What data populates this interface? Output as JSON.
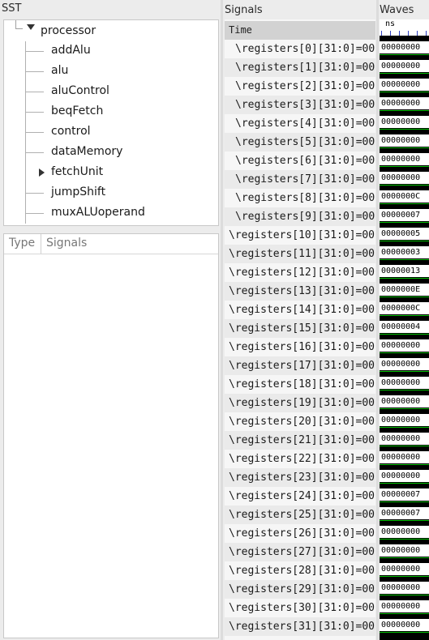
{
  "sst": {
    "label": "SST",
    "root": "processor",
    "children": [
      {
        "label": "addAlu",
        "expandable": false
      },
      {
        "label": "alu",
        "expandable": false
      },
      {
        "label": "aluControl",
        "expandable": false
      },
      {
        "label": "beqFetch",
        "expandable": false
      },
      {
        "label": "control",
        "expandable": false
      },
      {
        "label": "dataMemory",
        "expandable": false
      },
      {
        "label": "fetchUnit",
        "expandable": true
      },
      {
        "label": "jumpShift",
        "expandable": false
      },
      {
        "label": "muxALUoperand",
        "expandable": false
      }
    ]
  },
  "type_panel": {
    "type_header": "Type",
    "signals_header": "Signals"
  },
  "signals": {
    "label": "Signals",
    "time_label": "Time",
    "rows": [
      "\\registers[0][31:0]=00",
      "\\registers[1][31:0]=00",
      "\\registers[2][31:0]=00",
      "\\registers[3][31:0]=00",
      "\\registers[4][31:0]=00",
      "\\registers[5][31:0]=00",
      "\\registers[6][31:0]=00",
      "\\registers[7][31:0]=00",
      "\\registers[8][31:0]=00",
      "\\registers[9][31:0]=00",
      "\\registers[10][31:0]=00",
      "\\registers[11][31:0]=00",
      "\\registers[12][31:0]=00",
      "\\registers[13][31:0]=00",
      "\\registers[14][31:0]=00",
      "\\registers[15][31:0]=00",
      "\\registers[16][31:0]=00",
      "\\registers[17][31:0]=00",
      "\\registers[18][31:0]=00",
      "\\registers[19][31:0]=00",
      "\\registers[20][31:0]=00",
      "\\registers[21][31:0]=00",
      "\\registers[22][31:0]=00",
      "\\registers[23][31:0]=00",
      "\\registers[24][31:0]=00",
      "\\registers[25][31:0]=00",
      "\\registers[26][31:0]=00",
      "\\registers[27][31:0]=00",
      "\\registers[28][31:0]=00",
      "\\registers[29][31:0]=00",
      "\\registers[30][31:0]=00",
      "\\registers[31][31:0]=00"
    ]
  },
  "waves": {
    "label": "Waves",
    "unit": "ns",
    "values": [
      "00000000",
      "00000000",
      "00000000",
      "00000000",
      "00000000",
      "00000000",
      "00000000",
      "00000000",
      "0000000C",
      "00000007",
      "00000005",
      "00000003",
      "00000013",
      "0000000E",
      "0000000C",
      "00000004",
      "00000000",
      "00000000",
      "00000000",
      "00000000",
      "00000000",
      "00000000",
      "00000000",
      "00000000",
      "00000007",
      "00000007",
      "00000000",
      "00000000",
      "00000000",
      "00000000",
      "00000000",
      "00000000"
    ],
    "colors": {
      "background": "#000000",
      "signal": "#00c000",
      "tick": "#3040c0"
    }
  }
}
